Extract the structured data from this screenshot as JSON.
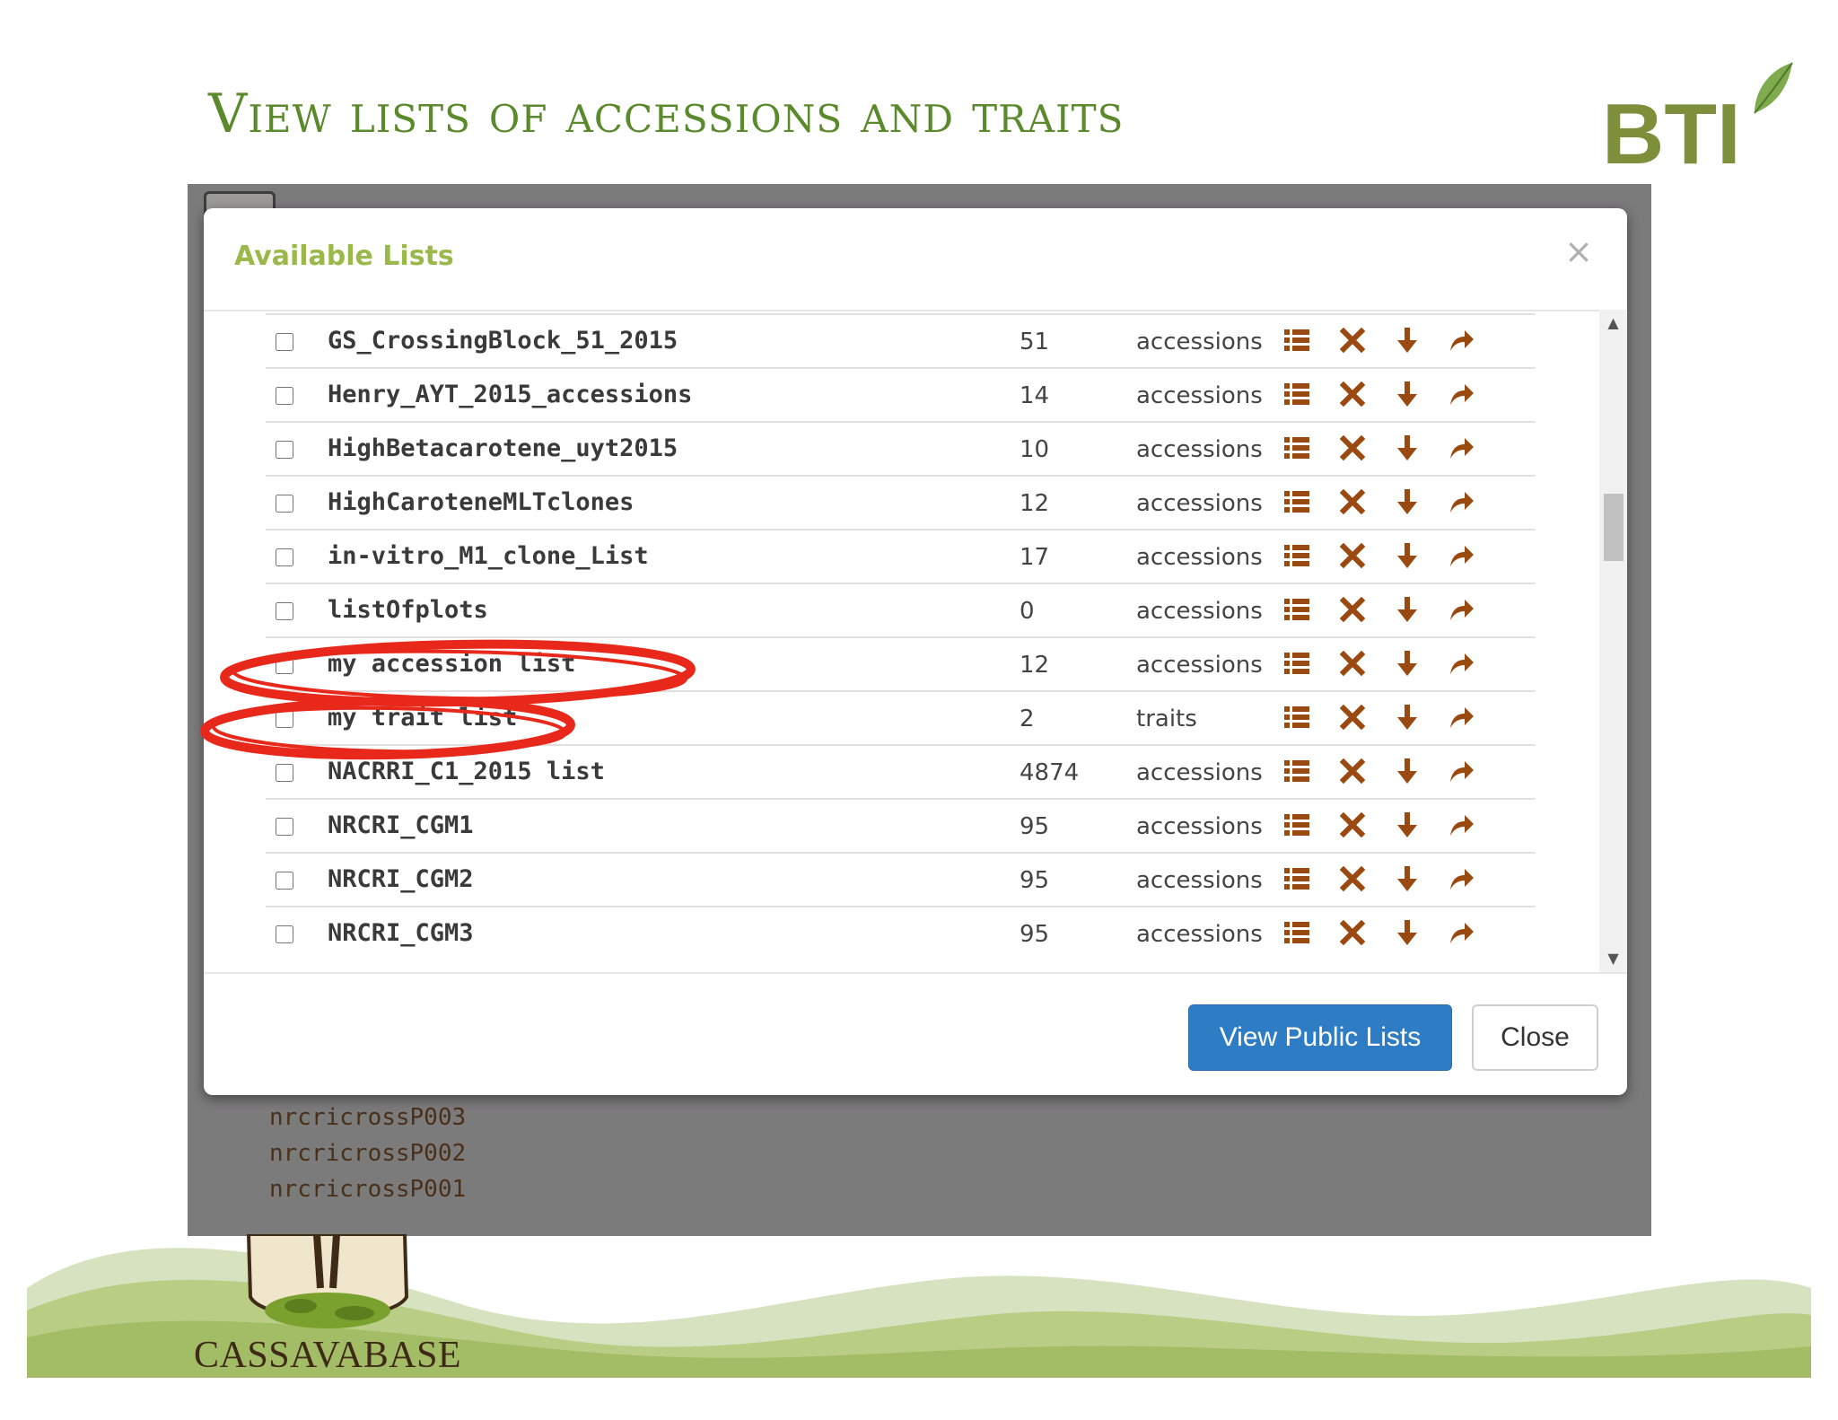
{
  "slide": {
    "title": "View lists of accessions and traits",
    "logo_text": "BTI",
    "footer_logo_text": "CASSAVABASE"
  },
  "modal": {
    "title": "Available Lists",
    "close_icon": "×",
    "rows": [
      {
        "name": "GS_CrossingBlock_51_2015",
        "count": "51",
        "type": "accessions"
      },
      {
        "name": "Henry_AYT_2015_accessions",
        "count": "14",
        "type": "accessions"
      },
      {
        "name": "HighBetacarotene_uyt2015",
        "count": "10",
        "type": "accessions"
      },
      {
        "name": "HighCaroteneMLTclones",
        "count": "12",
        "type": "accessions"
      },
      {
        "name": "in-vitro_M1_clone_List",
        "count": "17",
        "type": "accessions"
      },
      {
        "name": "listOfplots",
        "count": "0",
        "type": "accessions"
      },
      {
        "name": "my accession list",
        "count": "12",
        "type": "accessions"
      },
      {
        "name": "my trait list",
        "count": "2",
        "type": "traits"
      },
      {
        "name": "NACRRI_C1_2015 list",
        "count": "4874",
        "type": "accessions"
      },
      {
        "name": "NRCRI_CGM1",
        "count": "95",
        "type": "accessions"
      },
      {
        "name": "NRCRI_CGM2",
        "count": "95",
        "type": "accessions"
      },
      {
        "name": "NRCRI_CGM3",
        "count": "95",
        "type": "accessions"
      }
    ],
    "row_icons": [
      "list-icon",
      "delete-icon",
      "download-icon",
      "share-icon"
    ],
    "buttons": {
      "public": "View Public Lists",
      "close": "Close"
    },
    "highlighted_rows": [
      "my accession list",
      "my trait list"
    ]
  },
  "background_items": [
    "nrcricrossP003",
    "nrcricrossP002",
    "nrcricrossP001"
  ],
  "colors": {
    "title": "#5b8a2c",
    "modal_title": "#9ab94a",
    "icon": "#9a4a10",
    "primary_button": "#2e7dc4",
    "highlight": "#e8281a",
    "overlay": "#7c7b7c"
  }
}
